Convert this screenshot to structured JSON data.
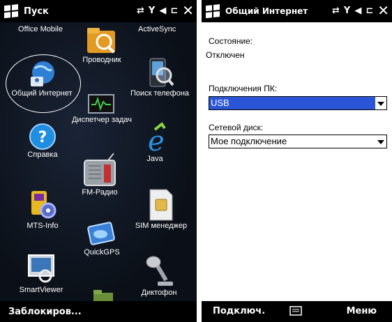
{
  "left": {
    "status_title": "Пуск",
    "apps": [
      {
        "id": "office-mobile",
        "label": "Office Mobile"
      },
      {
        "id": "provodnik",
        "label": "Проводник"
      },
      {
        "id": "activesync",
        "label": "ActiveSync"
      },
      {
        "id": "obshchiy-internet",
        "label": "Общий Интернет"
      },
      {
        "id": "poisk-telefona",
        "label": "Поиск телефона"
      },
      {
        "id": "dispetcher-zadach",
        "label": "Диспетчер задач"
      },
      {
        "id": "spravka",
        "label": "Справка"
      },
      {
        "id": "java",
        "label": "Java"
      },
      {
        "id": "fm-radio",
        "label": "FM-Радио"
      },
      {
        "id": "mts-info",
        "label": "MTS-Info"
      },
      {
        "id": "sim-menedzher",
        "label": "SIM менеджер"
      },
      {
        "id": "quickgps",
        "label": "QuickGPS"
      },
      {
        "id": "smartviewer",
        "label": "SmartViewer"
      },
      {
        "id": "diktofon",
        "label": "Диктофон"
      }
    ],
    "softkey_left": "Заблокиров..."
  },
  "right": {
    "status_title": "Общий Интернет",
    "state_label": "Состояние:",
    "state_value": "Отключен",
    "pc_label": "Подключения ПК:",
    "pc_value": "USB",
    "net_label": "Сетевой диск:",
    "net_value": "Мое подключение",
    "softkey_left": "Подключ.",
    "softkey_right": "Меню"
  },
  "colors": {
    "selection": "#2a55d6",
    "statusbar": "#000000"
  }
}
